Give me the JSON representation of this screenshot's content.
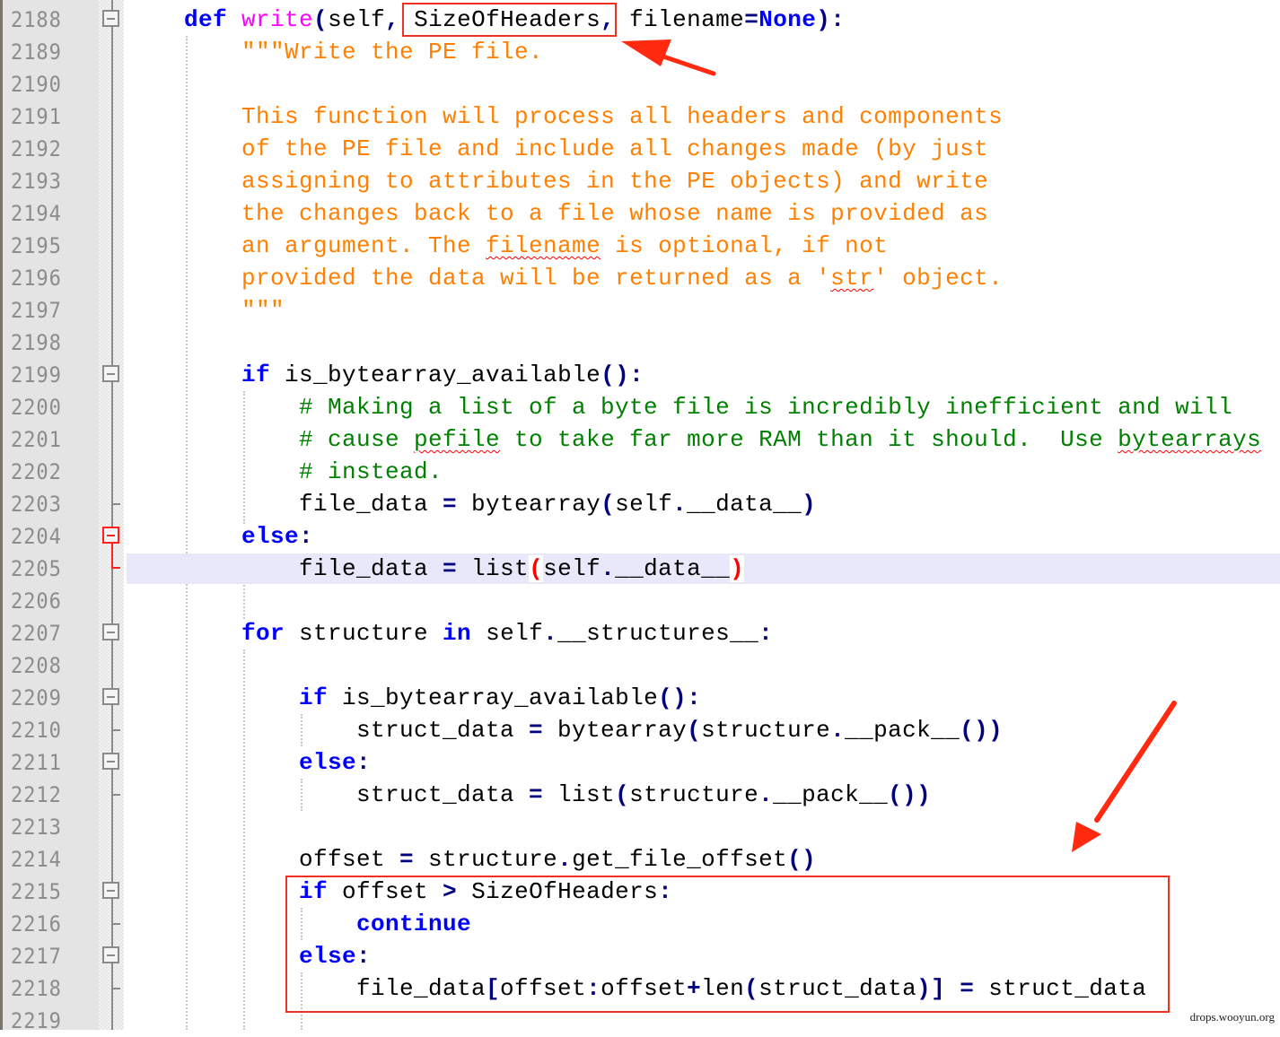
{
  "editor": {
    "language": "python",
    "colors": {
      "keyword": "#0000ff",
      "function_name": "#ff00ff",
      "operator": "#000080",
      "docstring": "#ff8000",
      "comment": "#008000",
      "brace_match": "#ff0000",
      "current_line": "#e8e8fa",
      "annotation": "#f03020"
    },
    "current_line": 2205,
    "lines": [
      {
        "n": "2188",
        "fold": "box",
        "indent": 4,
        "tokens": [
          [
            "kw",
            "def"
          ],
          [
            "",
            "  "
          ],
          [
            "fn",
            "write"
          ],
          [
            "op",
            "("
          ],
          [
            "",
            "self"
          ],
          [
            "op",
            ","
          ],
          [
            "",
            "  SizeOfHeaders"
          ],
          [
            "op",
            ","
          ],
          [
            "",
            "  filename"
          ],
          [
            "op",
            "="
          ],
          [
            "kw",
            "None"
          ],
          [
            "op",
            ")"
          ],
          [
            "op",
            ":"
          ]
        ]
      },
      {
        "n": "2189",
        "fold": "line",
        "indent": 8,
        "tokens": [
          [
            "str",
            "\"\"\"Write the PE file."
          ]
        ]
      },
      {
        "n": "2190",
        "fold": "line",
        "indent": 8,
        "tokens": []
      },
      {
        "n": "2191",
        "fold": "line",
        "indent": 8,
        "tokens": [
          [
            "str",
            "This function will process all headers and components"
          ]
        ]
      },
      {
        "n": "2192",
        "fold": "line",
        "indent": 8,
        "tokens": [
          [
            "str",
            "of the PE file and include all changes made (by just"
          ]
        ]
      },
      {
        "n": "2193",
        "fold": "line",
        "indent": 8,
        "tokens": [
          [
            "str",
            "assigning to attributes in the PE objects) and write"
          ]
        ]
      },
      {
        "n": "2194",
        "fold": "line",
        "indent": 8,
        "tokens": [
          [
            "str",
            "the changes back to a file whose name is provided as"
          ]
        ]
      },
      {
        "n": "2195",
        "fold": "line",
        "indent": 8,
        "tokens": [
          [
            "str",
            "an argument. The "
          ],
          [
            "str squiggle",
            "filename"
          ],
          [
            "str",
            " is optional, if not"
          ]
        ]
      },
      {
        "n": "2196",
        "fold": "line",
        "indent": 8,
        "tokens": [
          [
            "str",
            "provided the data will be returned as a '"
          ],
          [
            "str squiggle",
            "str"
          ],
          [
            "str",
            "' object."
          ]
        ]
      },
      {
        "n": "2197",
        "fold": "line",
        "indent": 8,
        "tokens": [
          [
            "str",
            "\"\"\""
          ]
        ]
      },
      {
        "n": "2198",
        "fold": "line",
        "indent": 8,
        "tokens": []
      },
      {
        "n": "2199",
        "fold": "box",
        "indent": 8,
        "tokens": [
          [
            "kw",
            "if"
          ],
          [
            "",
            " is_bytearray_available"
          ],
          [
            "op",
            "()"
          ],
          [
            "op",
            ":"
          ]
        ]
      },
      {
        "n": "2200",
        "fold": "line",
        "indent": 12,
        "tokens": [
          [
            "cm",
            "# Making a list of a byte file is incredibly inefficient and will"
          ]
        ]
      },
      {
        "n": "2201",
        "fold": "line",
        "indent": 12,
        "tokens": [
          [
            "cm",
            "# cause "
          ],
          [
            "cm squiggle",
            "pefile"
          ],
          [
            "cm",
            " to take far more RAM than it should.  Use "
          ],
          [
            "cm squiggle",
            "bytearrays"
          ]
        ]
      },
      {
        "n": "2202",
        "fold": "line",
        "indent": 12,
        "tokens": [
          [
            "cm",
            "# instead."
          ]
        ]
      },
      {
        "n": "2203",
        "fold": "tick",
        "indent": 12,
        "tokens": [
          [
            "",
            "file_data "
          ],
          [
            "op",
            "="
          ],
          [
            "",
            " bytearray"
          ],
          [
            "op",
            "("
          ],
          [
            "",
            "self"
          ],
          [
            "op",
            "."
          ],
          [
            "",
            "__data__"
          ],
          [
            "op",
            ")"
          ]
        ]
      },
      {
        "n": "2204",
        "fold": "box-red",
        "indent": 8,
        "tokens": [
          [
            "kw",
            "else"
          ],
          [
            "op",
            ":"
          ]
        ]
      },
      {
        "n": "2205",
        "fold": "tick-red",
        "indent": 12,
        "tokens": [
          [
            "",
            "file_data "
          ],
          [
            "op",
            "="
          ],
          [
            "",
            " list"
          ],
          [
            "brace-hl",
            "("
          ],
          [
            "",
            "self"
          ],
          [
            "op",
            "."
          ],
          [
            "",
            "__data__"
          ],
          [
            "brace-hl",
            ")"
          ]
        ]
      },
      {
        "n": "2206",
        "fold": "line",
        "indent": 8,
        "tokens": []
      },
      {
        "n": "2207",
        "fold": "box",
        "indent": 8,
        "tokens": [
          [
            "kw",
            "for"
          ],
          [
            "",
            " structure "
          ],
          [
            "kw",
            "in"
          ],
          [
            "",
            " self"
          ],
          [
            "op",
            "."
          ],
          [
            "",
            "__structures__"
          ],
          [
            "op",
            ":"
          ]
        ]
      },
      {
        "n": "2208",
        "fold": "line",
        "indent": 12,
        "tokens": []
      },
      {
        "n": "2209",
        "fold": "box",
        "indent": 12,
        "tokens": [
          [
            "kw",
            "if"
          ],
          [
            "",
            " is_bytearray_available"
          ],
          [
            "op",
            "()"
          ],
          [
            "op",
            ":"
          ]
        ]
      },
      {
        "n": "2210",
        "fold": "tick",
        "indent": 16,
        "tokens": [
          [
            "",
            "struct_data "
          ],
          [
            "op",
            "="
          ],
          [
            "",
            " bytearray"
          ],
          [
            "op",
            "("
          ],
          [
            "",
            "structure"
          ],
          [
            "op",
            "."
          ],
          [
            "",
            "__pack__"
          ],
          [
            "op",
            "())"
          ]
        ]
      },
      {
        "n": "2211",
        "fold": "box",
        "indent": 12,
        "tokens": [
          [
            "kw",
            "else"
          ],
          [
            "op",
            ":"
          ]
        ]
      },
      {
        "n": "2212",
        "fold": "tick",
        "indent": 16,
        "tokens": [
          [
            "",
            "struct_data "
          ],
          [
            "op",
            "="
          ],
          [
            "",
            " list"
          ],
          [
            "op",
            "("
          ],
          [
            "",
            "structure"
          ],
          [
            "op",
            "."
          ],
          [
            "",
            "__pack__"
          ],
          [
            "op",
            "())"
          ]
        ]
      },
      {
        "n": "2213",
        "fold": "line",
        "indent": 12,
        "tokens": []
      },
      {
        "n": "2214",
        "fold": "line",
        "indent": 12,
        "tokens": [
          [
            "",
            "offset "
          ],
          [
            "op",
            "="
          ],
          [
            "",
            " structure"
          ],
          [
            "op",
            "."
          ],
          [
            "",
            "get_file_offset"
          ],
          [
            "op",
            "()"
          ]
        ]
      },
      {
        "n": "2215",
        "fold": "box",
        "indent": 12,
        "tokens": [
          [
            "kw",
            "if"
          ],
          [
            "",
            " offset "
          ],
          [
            "op",
            ">"
          ],
          [
            "",
            " SizeOfHeaders"
          ],
          [
            "op",
            ":"
          ]
        ]
      },
      {
        "n": "2216",
        "fold": "tick",
        "indent": 16,
        "tokens": [
          [
            "kw",
            "continue"
          ]
        ]
      },
      {
        "n": "2217",
        "fold": "box",
        "indent": 12,
        "tokens": [
          [
            "kw",
            "else"
          ],
          [
            "op",
            ":"
          ]
        ]
      },
      {
        "n": "2218",
        "fold": "tick",
        "indent": 16,
        "tokens": [
          [
            "",
            "file_data"
          ],
          [
            "op",
            "["
          ],
          [
            "",
            "offset"
          ],
          [
            "op",
            ":"
          ],
          [
            "",
            "offset"
          ],
          [
            "op",
            "+"
          ],
          [
            "",
            "len"
          ],
          [
            "op",
            "("
          ],
          [
            "",
            "struct_data"
          ],
          [
            "op",
            ")]"
          ],
          [
            "",
            " "
          ],
          [
            "op",
            "="
          ],
          [
            "",
            " struct_data"
          ]
        ]
      },
      {
        "n": "2219",
        "fold": "line",
        "indent": 12,
        "tokens": []
      }
    ]
  },
  "annotations": {
    "highlight_param": "SizeOfHeaders",
    "highlight_block_lines": [
      "2215",
      "2218"
    ],
    "arrow_count": 2
  },
  "watermark": "drops.wooyun.org"
}
